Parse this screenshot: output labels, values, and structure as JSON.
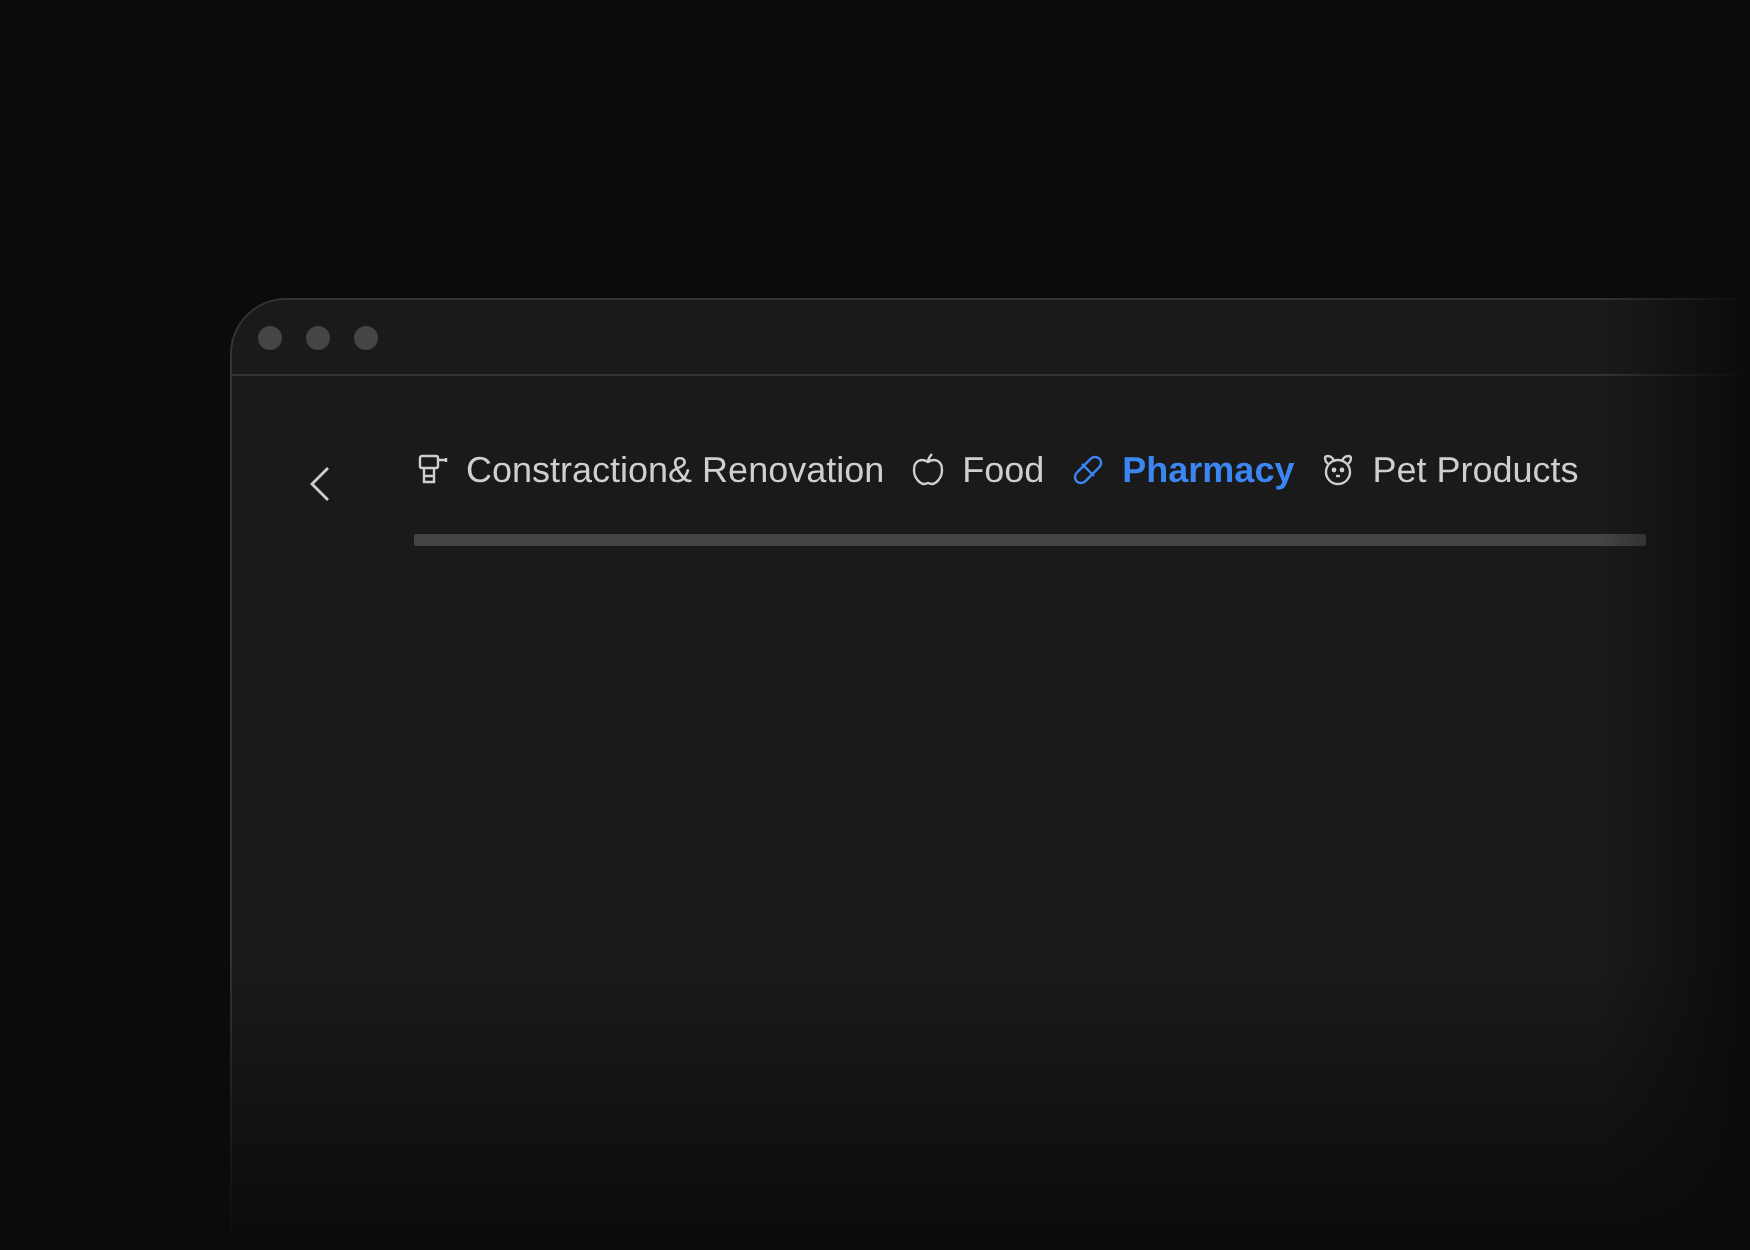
{
  "tabs": [
    {
      "label": "Constraction& Renovation",
      "selected": false
    },
    {
      "label": "Food",
      "selected": false
    },
    {
      "label": "Pharmacy",
      "selected": true
    },
    {
      "label": "Pet Products",
      "selected": false
    }
  ]
}
